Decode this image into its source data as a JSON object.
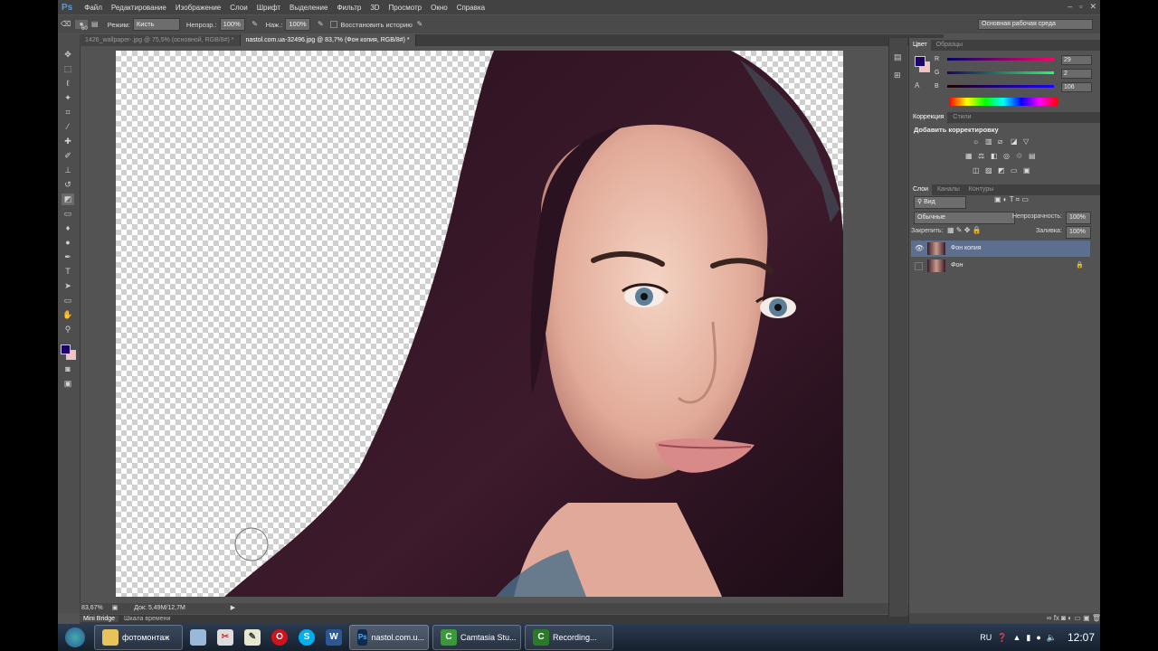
{
  "app": {
    "logo": "Ps"
  },
  "menu": [
    "Файл",
    "Редактирование",
    "Изображение",
    "Слои",
    "Шрифт",
    "Выделение",
    "Фильтр",
    "3D",
    "Просмотр",
    "Окно",
    "Справка"
  ],
  "options": {
    "brush_size": "60",
    "mode_label": "Режим:",
    "mode_value": "Кисть",
    "opacity_label": "Непрозр.:",
    "opacity_value": "100%",
    "flow_label": "Наж.:",
    "flow_value": "100%",
    "history_label": "Восстановить историю",
    "workspace": "Основная рабочая среда"
  },
  "tabs": [
    {
      "label": "1426_wallpaper-.jpg @ 75,5% (основной, RGB/8#) *",
      "active": false
    },
    {
      "label": "nastol.com.ua-32496.jpg @ 83,7% (Фон копия, RGB/8#) *",
      "active": true
    }
  ],
  "status": {
    "zoom": "83,67%",
    "doc": "Док: 5,49M/12,7M"
  },
  "bottom_tabs": [
    "Mini Bridge",
    "Шкала времени"
  ],
  "color_panel": {
    "tabs": [
      "Цвет",
      "Образцы"
    ],
    "r_label": "R",
    "g_label": "G",
    "b_label": "B",
    "r": "29",
    "g": "2",
    "b": "106",
    "fg_color": "#1d026a",
    "bg_color": "#f2c4c4"
  },
  "adjust_panel": {
    "tabs": [
      "Коррекция",
      "Стили"
    ],
    "title": "Добавить корректировку"
  },
  "layers_panel": {
    "tabs": [
      "Слои",
      "Каналы",
      "Контуры"
    ],
    "filter": "Вид",
    "blend": "Обычные",
    "opacity_label": "Непрозрачность:",
    "opacity": "100%",
    "lock_label": "Закрепить:",
    "fill_label": "Заливка:",
    "fill": "100%",
    "layers": [
      {
        "name": "Фон копия",
        "selected": true
      },
      {
        "name": "Фон",
        "selected": false
      }
    ]
  },
  "taskbar": {
    "items": [
      {
        "label": "фотомонтаж",
        "icon": "folder-icon"
      },
      {
        "label": "",
        "icon": "notepad-icon"
      },
      {
        "label": "",
        "icon": "paint-icon"
      },
      {
        "label": "",
        "icon": "notes-icon"
      },
      {
        "label": "",
        "icon": "opera-icon"
      },
      {
        "label": "",
        "icon": "skype-icon"
      },
      {
        "label": "",
        "icon": "word-icon"
      },
      {
        "label": "nastol.com.u...",
        "icon": "photoshop-icon"
      },
      {
        "label": "Camtasia Stu...",
        "icon": "camtasia-icon"
      },
      {
        "label": "Recording...",
        "icon": "recording-icon"
      }
    ],
    "lang": "RU",
    "time": "12:07"
  }
}
